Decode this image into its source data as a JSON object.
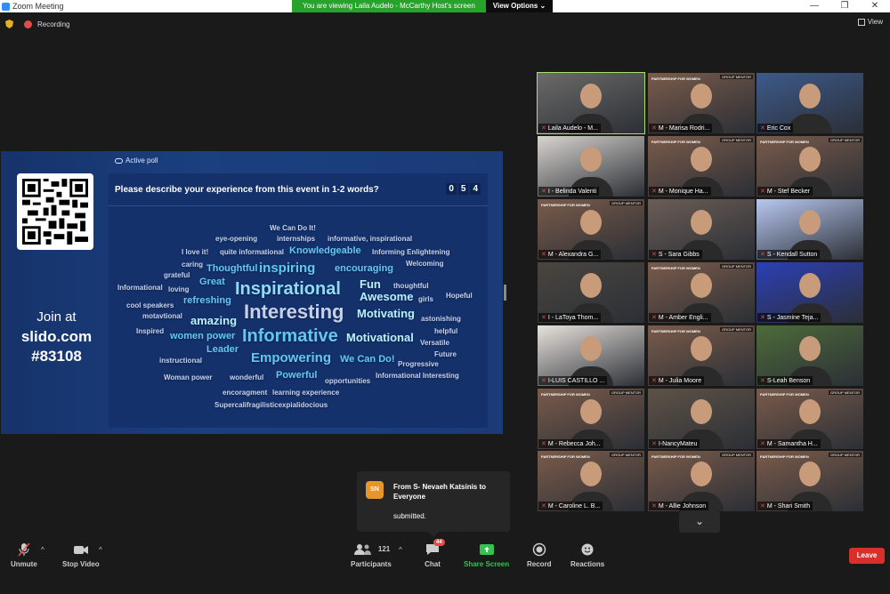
{
  "window": {
    "title": "Zoom Meeting",
    "banner": "You are viewing Laila Audelo - McCarthy Host's screen",
    "view_options": "View Options ⌄",
    "controls": [
      "—",
      "❐",
      "✕"
    ]
  },
  "topbar": {
    "recording": "Recording",
    "view": "View"
  },
  "share": {
    "join_at": "Join at",
    "site": "slido.com",
    "code": "#83108",
    "active_poll": "Active poll",
    "question": "Please describe your experience from this event in 1-2 words?",
    "counter": [
      "0",
      "5",
      "4"
    ]
  },
  "wordcloud": [
    {
      "t": "We Can Do It!",
      "c": "#c7d2ea",
      "s": 8
    },
    {
      "t": "eye-opening",
      "c": "#c7d2ea",
      "s": 8
    },
    {
      "t": "internships",
      "c": "#c7d2ea",
      "s": 8
    },
    {
      "t": "informative, inspirational",
      "c": "#c7d2ea",
      "s": 8
    },
    {
      "t": "I love it!",
      "c": "#c7d2ea",
      "s": 8
    },
    {
      "t": "quite informational",
      "c": "#c7d2ea",
      "s": 8
    },
    {
      "t": "Knowledgeable",
      "c": "#62c8f2",
      "s": 11
    },
    {
      "t": "Informing Enlightening",
      "c": "#c7d2ea",
      "s": 8
    },
    {
      "t": "caring",
      "c": "#c7d2ea",
      "s": 8
    },
    {
      "t": "Welcoming",
      "c": "#c7d2ea",
      "s": 8
    },
    {
      "t": "Thoughtful",
      "c": "#62c8f2",
      "s": 11
    },
    {
      "t": "inspiring",
      "c": "#62c8f2",
      "s": 15
    },
    {
      "t": "encouraging",
      "c": "#62c8f2",
      "s": 11
    },
    {
      "t": "grateful",
      "c": "#c7d2ea",
      "s": 8
    },
    {
      "t": "Great",
      "c": "#62c8f2",
      "s": 11
    },
    {
      "t": "Fun",
      "c": "#b9f1ff",
      "s": 13
    },
    {
      "t": "thoughtful",
      "c": "#c7d2ea",
      "s": 8
    },
    {
      "t": "Informational",
      "c": "#c7d2ea",
      "s": 8
    },
    {
      "t": "loving",
      "c": "#c7d2ea",
      "s": 8
    },
    {
      "t": "Inspirational",
      "c": "#8fdcf7",
      "s": 20
    },
    {
      "t": "Awesome",
      "c": "#b9f1ff",
      "s": 13
    },
    {
      "t": "girls",
      "c": "#c7d2ea",
      "s": 8
    },
    {
      "t": "Hopeful",
      "c": "#c7d2ea",
      "s": 8
    },
    {
      "t": "cool speakers",
      "c": "#c7d2ea",
      "s": 8
    },
    {
      "t": "refreshing",
      "c": "#62c8f2",
      "s": 11
    },
    {
      "t": "Interesting",
      "c": "#c7d2ea",
      "s": 22
    },
    {
      "t": "Motivating",
      "c": "#b9f1ff",
      "s": 13
    },
    {
      "t": "motavtional",
      "c": "#c7d2ea",
      "s": 8
    },
    {
      "t": "astonishing",
      "c": "#c7d2ea",
      "s": 8
    },
    {
      "t": "amazing",
      "c": "#b9f1ff",
      "s": 13
    },
    {
      "t": "Inspired",
      "c": "#c7d2ea",
      "s": 8
    },
    {
      "t": "helpful",
      "c": "#c7d2ea",
      "s": 8
    },
    {
      "t": "women power",
      "c": "#62c8f2",
      "s": 11
    },
    {
      "t": "Informative",
      "c": "#62c8f2",
      "s": 20
    },
    {
      "t": "Motivational",
      "c": "#b9f1ff",
      "s": 13
    },
    {
      "t": "Versatile",
      "c": "#c7d2ea",
      "s": 8
    },
    {
      "t": "Leader",
      "c": "#62c8f2",
      "s": 11
    },
    {
      "t": "Future",
      "c": "#c7d2ea",
      "s": 8
    },
    {
      "t": "instructional",
      "c": "#c7d2ea",
      "s": 8
    },
    {
      "t": "Empowering",
      "c": "#62c8f2",
      "s": 15
    },
    {
      "t": "We Can Do!",
      "c": "#62c8f2",
      "s": 11
    },
    {
      "t": "Progressive",
      "c": "#c7d2ea",
      "s": 8
    },
    {
      "t": "Woman power",
      "c": "#c7d2ea",
      "s": 8
    },
    {
      "t": "wonderful",
      "c": "#c7d2ea",
      "s": 8
    },
    {
      "t": "Powerful",
      "c": "#62c8f2",
      "s": 11
    },
    {
      "t": "opportunities",
      "c": "#c7d2ea",
      "s": 8
    },
    {
      "t": "Informational Interesting",
      "c": "#c7d2ea",
      "s": 8
    },
    {
      "t": "encoragment",
      "c": "#c7d2ea",
      "s": 8
    },
    {
      "t": "learning experience",
      "c": "#c7d2ea",
      "s": 8
    },
    {
      "t": "Supercalifragilisticexpialidocious",
      "c": "#c7d2ea",
      "s": 8
    }
  ],
  "participants": [
    {
      "name": "Laila Audelo - M...",
      "bg": "#6b6a68"
    },
    {
      "name": "M - Marisa Rodri...",
      "bg": "#7a5b4a"
    },
    {
      "name": "Eric Cox",
      "bg": "#3d5a8a"
    },
    {
      "name": "I - Belinda Valenti",
      "bg": "#d8d4cf"
    },
    {
      "name": "M - Monique Ha...",
      "bg": "#7a5b4a"
    },
    {
      "name": "M - Stef Becker",
      "bg": "#7a5b4a"
    },
    {
      "name": "M - Alexandra G...",
      "bg": "#7a5b4a"
    },
    {
      "name": "S - Sara Gibbs",
      "bg": "#6b5d55"
    },
    {
      "name": "S - Kendall Sutton",
      "bg": "#b7c7f0"
    },
    {
      "name": "I - LaToya Thom...",
      "bg": "#4a4640"
    },
    {
      "name": "M - Amber Engli...",
      "bg": "#7a5b4a"
    },
    {
      "name": "S - Jasmine Teja...",
      "bg": "#2b3fb5"
    },
    {
      "name": "I-LUIS CASTILLO ...",
      "bg": "#e7e2dc"
    },
    {
      "name": "M - Julia Moore",
      "bg": "#7a5b4a"
    },
    {
      "name": "S-Leah Benson",
      "bg": "#4d6b3a"
    },
    {
      "name": "M - Rebecca Joh...",
      "bg": "#7a5b4a"
    },
    {
      "name": "I-NancyMateu",
      "bg": "#5e5246"
    },
    {
      "name": "M - Samantha H...",
      "bg": "#7a5b4a"
    },
    {
      "name": "M - Caroline L. B...",
      "bg": "#7a5b4a"
    },
    {
      "name": "M - Allie Johnson",
      "bg": "#7a5b4a"
    },
    {
      "name": "M - Shari Smith",
      "bg": "#7a5b4a"
    }
  ],
  "tile_brand": "PARTNERSHIP FOR WOMEN",
  "tile_tag": "GROUP MENTOR",
  "chat_popup": {
    "initials": "SN",
    "from": "From S- Nevaeh Katsinis to Everyone",
    "message": "submitted."
  },
  "toolbar": {
    "unmute": "Unmute",
    "stop_video": "Stop Video",
    "participants": "Participants",
    "participant_count": "121",
    "chat": "Chat",
    "chat_badge": "44",
    "share_screen": "Share Screen",
    "record": "Record",
    "reactions": "Reactions",
    "leave": "Leave"
  }
}
